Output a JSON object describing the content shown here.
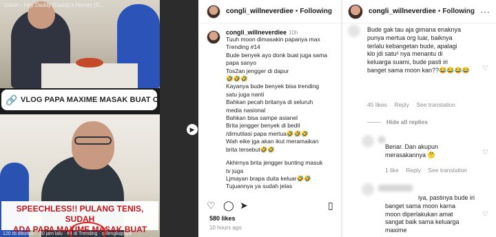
{
  "media": {
    "song": "Usher - Hey Daddy (Daddy's Home) (S...",
    "banner_text": "VLOG PAPA MAXIME MASAK BUAT CALON...",
    "caption_lines": [
      "SPEECHLESS!! PULANG TENIS, SUDAH",
      "ADA PAPA MAXIME MASAK BUAT LUNA!"
    ],
    "meta_text": "120 rb ditonton · 20 jam lalu · #4 di Trending · selengkapnya",
    "link_icon": "link-icon",
    "accent_color": "#c0141c"
  },
  "post": {
    "username": "congli_willneverdiee",
    "follow_label": "Following",
    "caption_username": "congli_willneverdiee",
    "caption_time": "10h",
    "caption_lines": [
      "Tuuh moon dimasakin papanya max",
      "Trending #14",
      "Bude benyek ayo donk buat juga sama",
      "papa sanyo",
      "Tos2an jengger di dapur",
      "🤣🤣🤣",
      "Kayanya bude benyek bisa trending",
      "satu juga nanti",
      "Bahkan pecah britanya di seluruh",
      "media nasional",
      "Bahkan bisa sampe asianel",
      "Brita jengger benyek di bedil",
      "/dimutilasi papa mertua🤣🤣🤣",
      "Wah eike jga akan ikut meramaikan",
      "brita tersebut🤣🤣",
      "",
      "Akhirnya brita jengger bunting masuk",
      "tv juga",
      "Ljmayan brapa duita keluar🤣🤣",
      "Tujuannya ya sudah jelas"
    ],
    "likes": "580 likes",
    "time_ago": "10 hours ago"
  },
  "comments": {
    "username": "congli_willneverdiee",
    "follow_label": "Following",
    "items": [
      {
        "lines": [
          "Bude gak tau aja gimana enaknya",
          "punya mertua org luar, baiknya",
          "terlalu kebangetan bude, apalagi",
          "klo jdi satu² nya menantu di",
          "keluarga suami, bude pasti iri",
          "banget sama moon kan??😂😂😂😂"
        ],
        "likes": "45 likes",
        "reply": "Reply",
        "translate": "See translation"
      },
      {
        "lines": [
          "Benar. Dan akupun",
          "merasakannya 🤔"
        ],
        "likes": "1 like",
        "reply": "Reply",
        "translate": "See translation"
      },
      {
        "lines": [
          "iya, pastinya bude iri",
          "banget sama moon karna",
          "moon diperlakukan amat",
          "sangat baik sama keluarga",
          "maxime"
        ]
      }
    ],
    "hide_label": "Hide all replies"
  }
}
